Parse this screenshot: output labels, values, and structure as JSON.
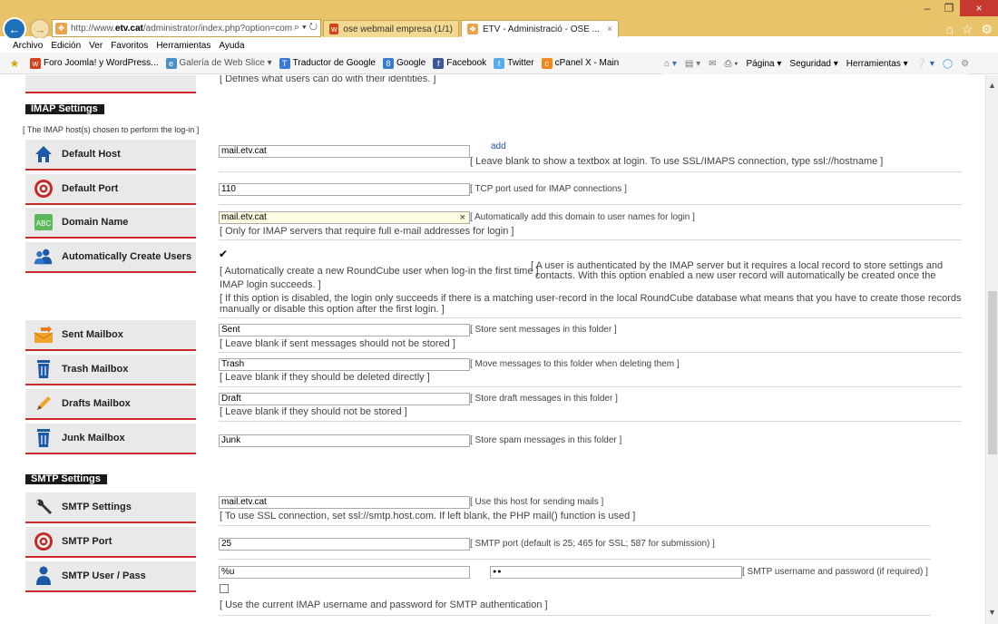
{
  "browser": {
    "url_prefix": "http://www.",
    "url_host": "etv.cat",
    "url_rest": "/administrator/index.php?option=com_",
    "tabs": [
      {
        "label": "ose webmail empresa (1/1)"
      },
      {
        "label": "ETV - Administració - OSE ..."
      }
    ],
    "menu": [
      "Archivo",
      "Edición",
      "Ver",
      "Favoritos",
      "Herramientas",
      "Ayuda"
    ],
    "favorites": [
      {
        "label": "Foro Joomla! y WordPress...",
        "icon": "w-icon",
        "color": "#d4421a"
      },
      {
        "label": "Galería de Web Slice ▾",
        "icon": "webslice-icon",
        "color": "#4a8fc7"
      },
      {
        "label": "Traductor de Google",
        "icon": "translate-icon",
        "color": "#3a7bd5"
      },
      {
        "label": "Google",
        "icon": "google-icon",
        "color": "#3a7bd5"
      },
      {
        "label": "Facebook",
        "icon": "facebook-icon",
        "color": "#3b5998"
      },
      {
        "label": "Twitter",
        "icon": "twitter-icon",
        "color": "#55acee"
      },
      {
        "label": "cPanel X - Main",
        "icon": "cpanel-icon",
        "color": "#f2871b"
      }
    ],
    "commands": [
      "Página ▾",
      "Seguridad ▾",
      "Herramientas ▾"
    ]
  },
  "page": {
    "top_partial_desc": "[ Defines what users can do with their identities. ]",
    "imap": {
      "header": "IMAP Settings",
      "note": "[ The IMAP host(s) chosen to perform the log-in ]",
      "default_host": {
        "label": "Default Host",
        "value": "mail.etv.cat",
        "add": "add",
        "help": "[ Leave blank to show a textbox at login. To use SSL/IMAPS connection, type ssl://hostname ]"
      },
      "default_port": {
        "label": "Default Port",
        "value": "110",
        "desc": "[ TCP port used for IMAP connections ]"
      },
      "domain_name": {
        "label": "Domain Name",
        "value": "mail.etv.cat",
        "clear": "×",
        "desc": "[ Automatically add this domain to user names for login ]",
        "help": "[ Only for IMAP servers that require full e-mail addresses for login ]"
      },
      "auto_create": {
        "label": "Automatically Create Users",
        "checked": "✔",
        "help1": "[ Automatically create a new RoundCube user when log-in the first time ]",
        "desc_a": "[ A user is authenticated by the IMAP server but it requires a local record to store settings and",
        "desc_b": "contacts. With this option enabled a new user record will automatically be created once the",
        "help2": "IMAP login succeeds. ]",
        "help3": "[ If this option is disabled, the login only succeeds if there is a matching user-record in the local RoundCube database what means that you have to create those records",
        "help4": "manually or disable this option after the first login. ]"
      },
      "sent": {
        "label": "Sent Mailbox",
        "value": "Sent",
        "desc": "[ Store sent messages in this folder ]",
        "help": "[ Leave blank if sent messages should not be stored ]"
      },
      "trash": {
        "label": "Trash Mailbox",
        "value": "Trash",
        "desc": "[ Move messages to this folder when deleting them ]",
        "help": "[ Leave blank if they should be deleted directly ]"
      },
      "drafts": {
        "label": "Drafts Mailbox",
        "value": "Draft",
        "desc": "[ Store draft messages in this folder ]",
        "help": "[ Leave blank if they should not be stored ]"
      },
      "junk": {
        "label": "Junk Mailbox",
        "value": "Junk",
        "desc": "[ Store spam messages in this folder ]"
      }
    },
    "smtp": {
      "header": "SMTP Settings",
      "settings": {
        "label": "SMTP Settings",
        "value": "mail.etv.cat",
        "desc": "[ Use this host for sending mails ]",
        "help": "[ To use SSL connection, set ssl://smtp.host.com. If left blank, the PHP mail() function is used ]"
      },
      "port": {
        "label": "SMTP Port",
        "value": "25",
        "desc": "[ SMTP port (default is 25; 465 for SSL; 587 for submission) ]"
      },
      "user_pass": {
        "label": "SMTP User / Pass",
        "user": "%u",
        "pass": "●●",
        "desc": "[ SMTP username and password (if required) ]",
        "help": "[ Use the current IMAP username and password for SMTP authentication ]"
      }
    }
  }
}
